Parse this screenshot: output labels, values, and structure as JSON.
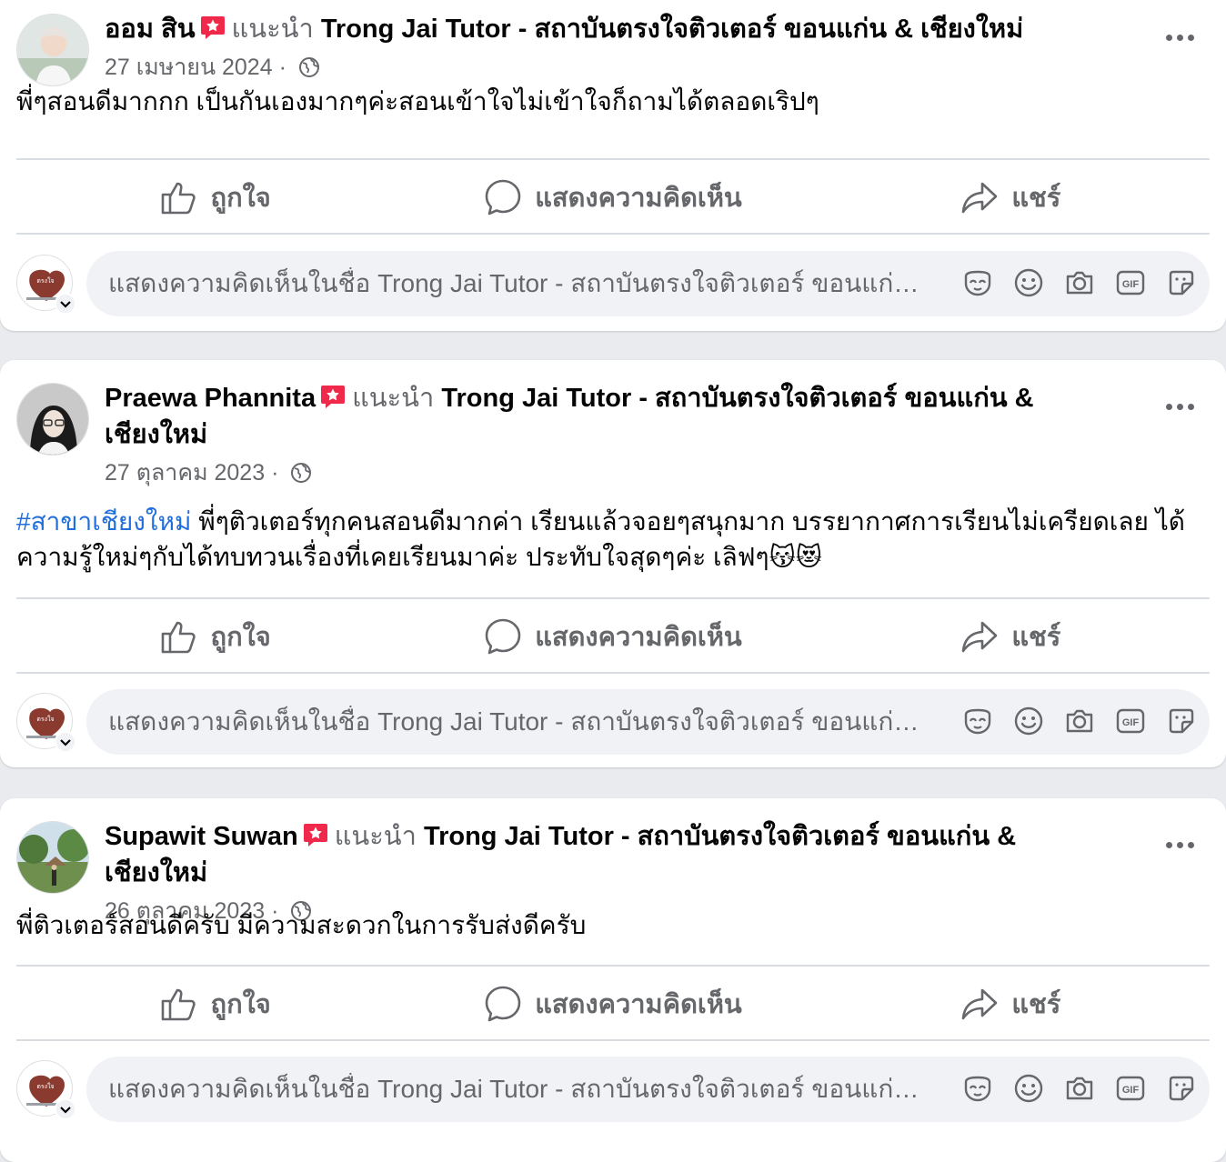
{
  "common": {
    "recommends": "แนะนำ",
    "page_name": "Trong Jai Tutor - สถาบันตรงใจติวเตอร์ ขอนแก่น & เชียงใหม่",
    "separator": "·",
    "like": "ถูกใจ",
    "comment": "แสดงความคิดเห็น",
    "share": "แชร์",
    "comment_placeholder": "แสดงความคิดเห็นในชื่อ Trong Jai Tutor - สถาบันตรงใจติวเตอร์ ขอนแก่น & เชียงใหม่"
  },
  "posts": [
    {
      "author": "ออม สิน",
      "date": "27 เมษายน 2024",
      "text": "พี่ๆสอนดีมากกก เป็นกันเองมากๆค่ะสอนเข้าใจไม่เข้าใจก็ถามได้ตลอดเริปๆ"
    },
    {
      "author": "Praewa Phannita",
      "date": "27 ตุลาคม 2023",
      "hashtag": "#สาขาเชียงใหม่",
      "text": " พี่ๆติวเตอร์ทุกคนสอนดีมากค่า เรียนแล้วจอยๆสนุกมาก บรรยากาศการเรียนไม่เครียดเลย ได้ความรู้ใหม่ๆกับได้ทบทวนเรื่องที่เคยเรียนมาค่ะ ประทับใจสุดๆค่ะ เลิฟๆ😽😻"
    },
    {
      "author": "Supawit Suwan",
      "date": "26 ตุลาคม 2023",
      "text": "พี่ติวเตอร์สอนดีครับ มีความสะดวกในการรับส่งดีครับ"
    }
  ],
  "colors": {
    "accent_link": "#216fdb",
    "recommend_badge": "#f02849",
    "secondary_text": "#65676b"
  }
}
